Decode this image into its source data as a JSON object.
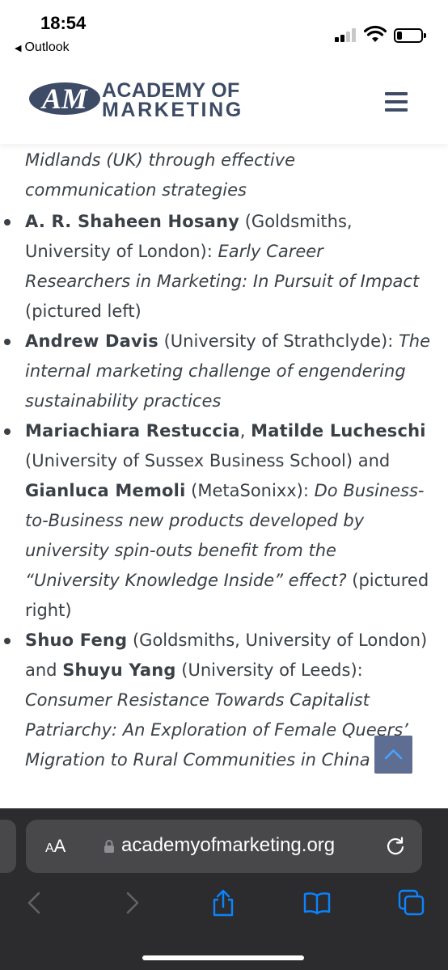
{
  "status_bar": {
    "time": "18:54",
    "back_app": "Outlook",
    "icons": [
      "cellular-signal-icon",
      "wifi-icon",
      "battery-icon"
    ]
  },
  "header": {
    "logo_line1": "ACADEMY OF",
    "logo_line2": "MARKETING",
    "brand_color": "#3d4b66",
    "menu_icon": "hamburger-menu-icon"
  },
  "article": {
    "continuation_text": "Midlands (UK) through effective communication strategies",
    "entries": [
      {
        "authors": "A. R. Shaheen Hosany",
        "affiliation": " (Goldsmiths, University of London): ",
        "title": "Early Career Researchers in Marketing: In Pursuit of Impact",
        "suffix": " (pictured left)"
      },
      {
        "authors": "Andrew Davis",
        "affiliation": " (University of Strathclyde): ",
        "title": "The internal marketing challenge of engendering sustainability practices",
        "suffix": ""
      },
      {
        "author1": "Mariachiara Restuccia",
        "sep1": ", ",
        "author2": "Matilde Lucheschi",
        "affiliation1": " (University of Sussex Business School) and ",
        "author3": "Gianluca Memoli",
        "affiliation2": " (MetaSonixx): ",
        "title": "Do Business-to-Business new products developed by university spin-outs benefit from the “University Knowledge Inside” effect?",
        "suffix": " (pictured right)"
      },
      {
        "author1": "Shuo Feng",
        "affiliation1": " (Goldsmiths, University of London) and ",
        "author2": "Shuyu Yang",
        "affiliation2": " (University of Leeds): ",
        "title": "Consumer Resistance Towards Capitalist Patriarchy: An Exploration of Female Queers’ Migration to Rural Communities in China"
      }
    ]
  },
  "scroll_top": {
    "icon": "chevron-up-icon",
    "color": "#5e6d92"
  },
  "browser": {
    "text_size_small": "A",
    "text_size_large": "A",
    "url": "academyofmarketing.org",
    "icons": [
      "lock-icon",
      "reload-icon",
      "back-arrow-icon",
      "forward-arrow-icon",
      "share-icon",
      "bookmarks-icon",
      "tabs-icon"
    ],
    "accent": "#0a84ff"
  }
}
